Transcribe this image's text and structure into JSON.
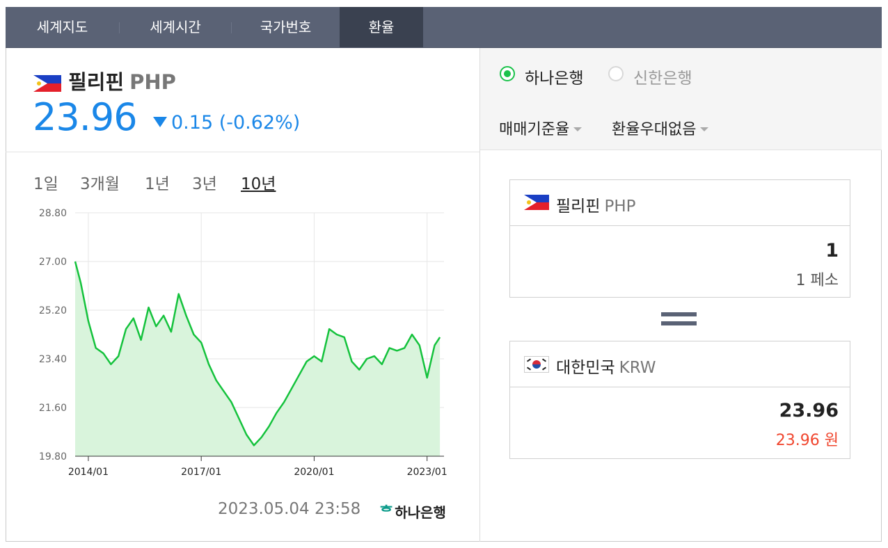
{
  "tabs": [
    {
      "label": "세계지도"
    },
    {
      "label": "세계시간"
    },
    {
      "label": "국가번호"
    },
    {
      "label": "환율"
    }
  ],
  "currency": {
    "country": "필리핀",
    "code": "PHP",
    "rate": "23.96",
    "change": "0.15 (-0.62%)",
    "direction": "down"
  },
  "periods": [
    {
      "label": "1일"
    },
    {
      "label": "3개월"
    },
    {
      "label": "1년"
    },
    {
      "label": "3년"
    },
    {
      "label": "10년"
    }
  ],
  "selected_period": "10년",
  "updated": "2023.05.04 23:58",
  "provider": "하나은행",
  "banks": [
    {
      "label": "하나은행",
      "selected": true
    },
    {
      "label": "신한은행",
      "selected": false
    }
  ],
  "options": {
    "rate_type": "매매기준율",
    "preference": "환율우대없음"
  },
  "converter": {
    "from": {
      "country": "필리핀",
      "code": "PHP",
      "amount": "1",
      "sub": "1 페소"
    },
    "to": {
      "country": "대한민국",
      "code": "KRW",
      "amount": "23.96",
      "sub": "23.96 원"
    }
  },
  "colors": {
    "tabbar": "#5a6275",
    "rate_blue": "#1a87e8",
    "line_green": "#14c23c",
    "fill_green": "#d9f4dc",
    "krw_red": "#f0452d"
  },
  "chart_data": {
    "type": "area",
    "xlabel": "",
    "ylabel": "",
    "ylim": [
      19.8,
      28.8
    ],
    "y_ticks": [
      "28.80",
      "27.00",
      "25.20",
      "23.40",
      "21.60",
      "19.80"
    ],
    "x_ticks": [
      "2014/01",
      "2017/01",
      "2020/01",
      "2023/01"
    ],
    "grid": true,
    "series": [
      {
        "x": [
          2013.65,
          2013.8,
          2014.0,
          2014.2,
          2014.4,
          2014.6,
          2014.8,
          2015.0,
          2015.2,
          2015.4,
          2015.6,
          2015.8,
          2016.0,
          2016.2,
          2016.4,
          2016.6,
          2016.8,
          2017.0,
          2017.2,
          2017.4,
          2017.6,
          2017.8,
          2018.0,
          2018.2,
          2018.4,
          2018.6,
          2018.8,
          2019.0,
          2019.2,
          2019.4,
          2019.6,
          2019.8,
          2020.0,
          2020.2,
          2020.4,
          2020.6,
          2020.8,
          2021.0,
          2021.2,
          2021.4,
          2021.6,
          2021.8,
          2022.0,
          2022.2,
          2022.4,
          2022.6,
          2022.8,
          2023.0,
          2023.2,
          2023.34
        ],
        "values": [
          27.0,
          26.2,
          24.8,
          23.8,
          23.6,
          23.2,
          23.5,
          24.5,
          24.9,
          24.1,
          25.3,
          24.6,
          25.0,
          24.4,
          25.8,
          25.0,
          24.3,
          24.0,
          23.2,
          22.6,
          22.2,
          21.8,
          21.2,
          20.6,
          20.2,
          20.5,
          20.9,
          21.4,
          21.8,
          22.3,
          22.8,
          23.3,
          23.5,
          23.3,
          24.5,
          24.3,
          24.2,
          23.3,
          23.0,
          23.4,
          23.5,
          23.2,
          23.8,
          23.7,
          23.8,
          24.3,
          23.9,
          22.7,
          23.9,
          24.2
        ]
      }
    ]
  }
}
